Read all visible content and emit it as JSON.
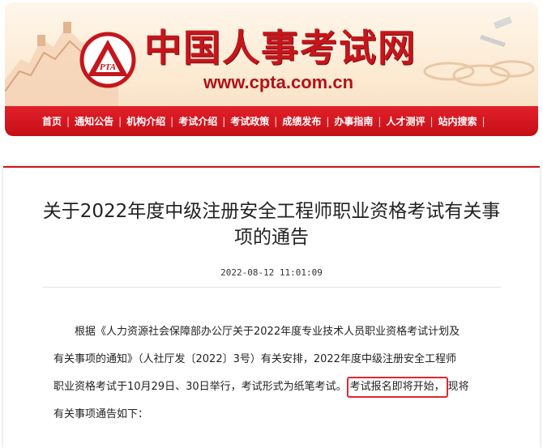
{
  "header": {
    "site_title": "中国人事考试网",
    "site_url": "www.cpta.com.cn",
    "logo_text": "PTA",
    "nav_items": [
      {
        "label": "首页"
      },
      {
        "label": "通知公告"
      },
      {
        "label": "机构介绍"
      },
      {
        "label": "考试介绍"
      },
      {
        "label": "考试政策"
      },
      {
        "label": "成绩发布"
      },
      {
        "label": "办事指南"
      },
      {
        "label": "人才测评"
      },
      {
        "label": "站内搜索"
      }
    ],
    "nav_separator": "|"
  },
  "article": {
    "title": "关于2022年度中级注册安全工程师职业资格考试有关事项的通告",
    "date": "2022-08-12 11:01:09",
    "body_lines": [
      "根据《人力资源社会保障部办公厅关于2022年度专业技术人员职业资格考试计划及",
      "有关事项的通知》（人社厅发〔2022〕3号）有关安排，2022年度中级注册安全工程师",
      "职业资格考试于10月29日、30日举行，考试形式为纸笔考试。",
      "考试报名即将开始，",
      "现将",
      "有关事项通告如下："
    ]
  },
  "colors": {
    "brand_red": "#c4161c",
    "nav_red": "#d41820",
    "highlight_border": "#e0282e"
  }
}
